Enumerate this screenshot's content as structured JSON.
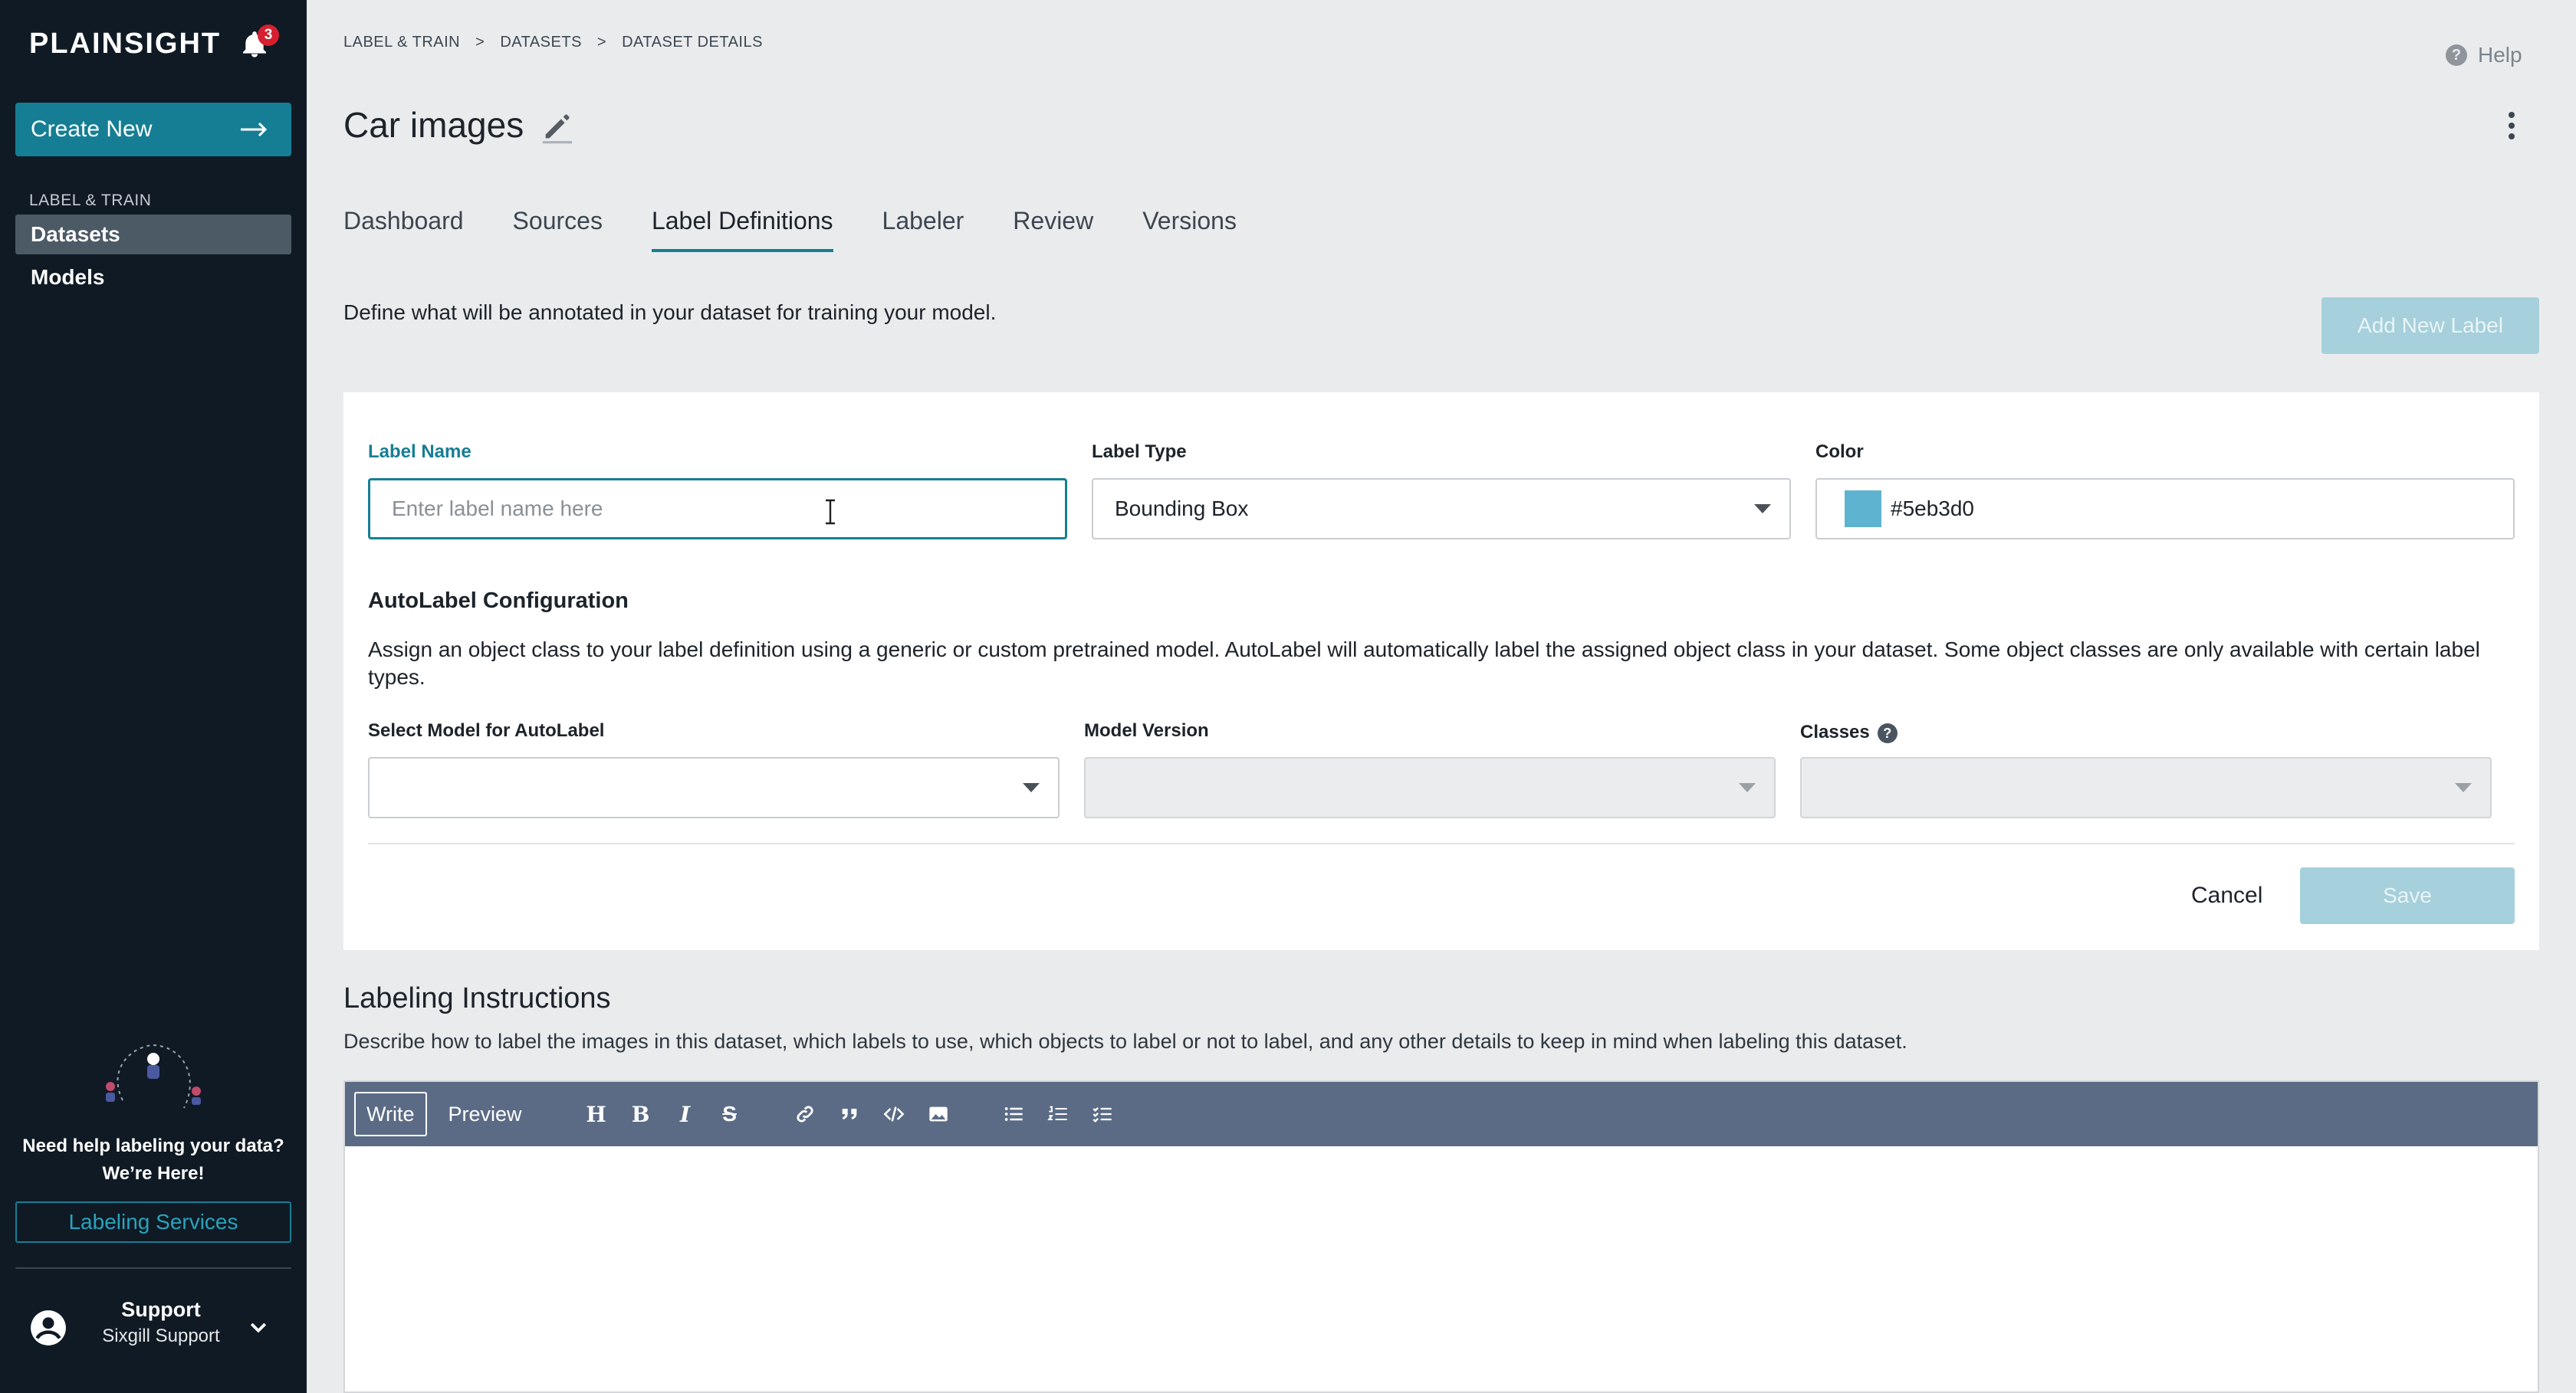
{
  "app": {
    "brand": "PLAINSIGHT",
    "notification_count": "3"
  },
  "sidebar": {
    "create_label": "Create New",
    "section_label": "LABEL & TRAIN",
    "items": [
      {
        "label": "Datasets",
        "active": true
      },
      {
        "label": "Models",
        "active": false
      }
    ],
    "help_line1": "Need help labeling your data?",
    "help_line2": "We’re Here!",
    "labeling_services": "Labeling Services",
    "user": {
      "name": "Support",
      "org": "Sixgill Support"
    }
  },
  "breadcrumb": [
    "LABEL & TRAIN",
    "DATASETS",
    "DATASET DETAILS"
  ],
  "breadcrumb_separator": ">",
  "help_label": "Help",
  "page_title": "Car images",
  "tabs": [
    {
      "label": "Dashboard"
    },
    {
      "label": "Sources"
    },
    {
      "label": "Label Definitions",
      "active": true
    },
    {
      "label": "Labeler"
    },
    {
      "label": "Review"
    },
    {
      "label": "Versions"
    }
  ],
  "intro": "Define what will be annotated in your dataset for training your model.",
  "add_new_label": "Add New Label",
  "form": {
    "label_name_label": "Label Name",
    "label_name_placeholder": "Enter label name here",
    "label_type_label": "Label Type",
    "label_type_value": "Bounding Box",
    "color_label": "Color",
    "color_value": "#5eb3d0",
    "autolabel_title": "AutoLabel Configuration",
    "autolabel_desc": "Assign an object class to your label definition using a generic or custom pretrained model. AutoLabel will automatically label the assigned object class in your dataset. Some object classes are only available with certain label types.",
    "select_model_label": "Select Model for AutoLabel",
    "model_version_label": "Model Version",
    "classes_label": "Classes",
    "cancel": "Cancel",
    "save": "Save"
  },
  "instructions": {
    "title": "Labeling Instructions",
    "desc": "Describe how to label the images in this dataset, which labels to use, which objects to label or not to label, and any other details to keep in mind when labeling this dataset.",
    "write_tab": "Write",
    "preview_tab": "Preview",
    "toolbar_icons": [
      "heading-icon",
      "bold-icon",
      "italic-icon",
      "strikethrough-icon",
      "link-icon",
      "quote-icon",
      "code-icon",
      "image-icon",
      "bulleted-list-icon",
      "numbered-list-icon",
      "task-list-icon"
    ]
  },
  "colors": {
    "accent": "#167e94",
    "sidebar_bg": "#0f1a24",
    "disabled_button": "#a6d0db",
    "toolbar_bg": "#5b6b85"
  }
}
